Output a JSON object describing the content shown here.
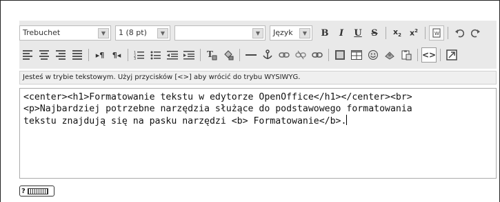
{
  "toolbar": {
    "font_family": "Trebuchet",
    "font_size": "1 (8 pt)",
    "paragraph_style": "",
    "language": "Język",
    "bold_label": "B",
    "italic_label": "I",
    "underline_label": "U",
    "strike_label": "S",
    "subscript_label": "x",
    "superscript_label": "x",
    "source_toggle_label": "<>"
  },
  "status": {
    "message": "Jesteś w trybie tekstowym. Użyj przycisków [<>] aby wrócić do trybu WYSIWYG."
  },
  "editor": {
    "line1": "<center><h1>Formatowanie tekstu w edytorze OpenOffice</h1></center><br>",
    "line2": "<p>Najbardziej potrzebne narzędzia służące do podstawowego formatowania",
    "line3": "tekstu znajdują się na pasku narzędzi <b> Formatowanie</b>."
  },
  "help": {
    "label": "?"
  }
}
